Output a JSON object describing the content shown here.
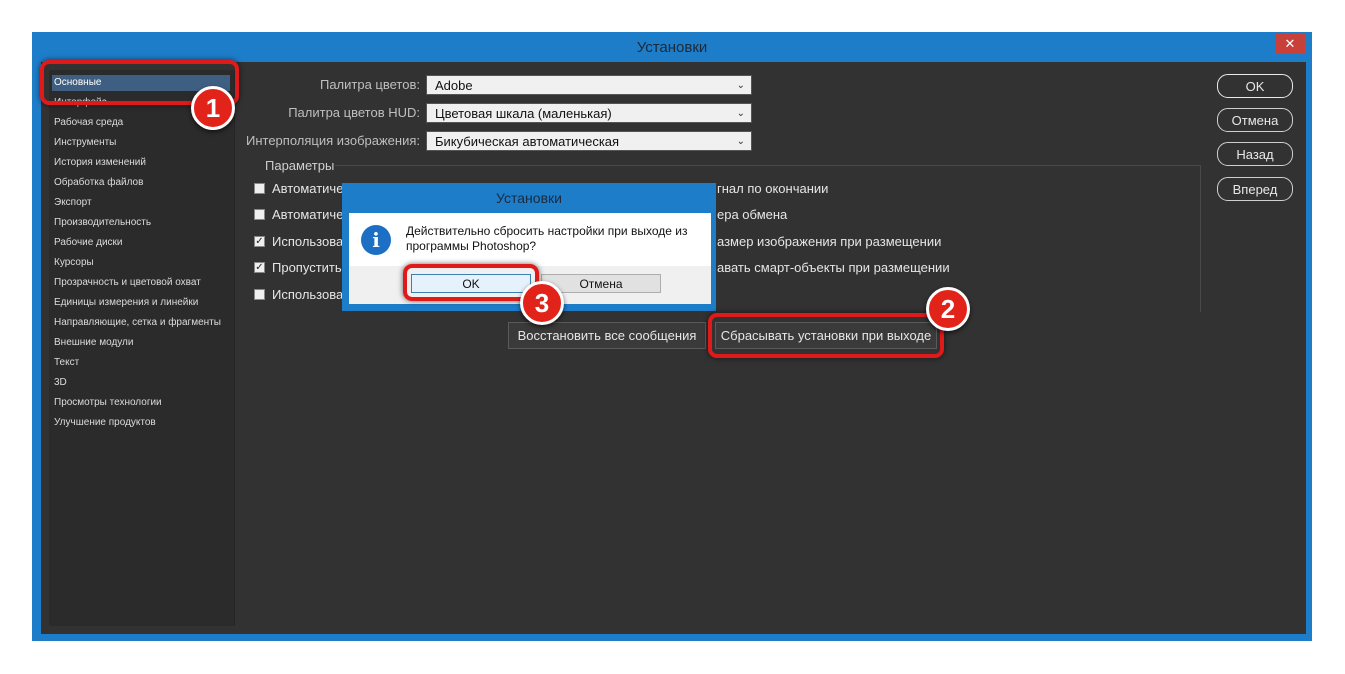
{
  "window": {
    "title": "Установки",
    "close_glyph": "✕"
  },
  "sidebar": {
    "items": [
      {
        "label": "Основные",
        "selected": true
      },
      {
        "label": "Интерфейс"
      },
      {
        "label": "Рабочая среда"
      },
      {
        "label": "Инструменты"
      },
      {
        "label": "История изменений"
      },
      {
        "label": "Обработка файлов"
      },
      {
        "label": "Экспорт"
      },
      {
        "label": "Производительность"
      },
      {
        "label": "Рабочие диски"
      },
      {
        "label": "Курсоры"
      },
      {
        "label": "Прозрачность и цветовой охват"
      },
      {
        "label": "Единицы измерения и линейки"
      },
      {
        "label": "Направляющие, сетка и фрагменты"
      },
      {
        "label": "Внешние модули"
      },
      {
        "label": "Текст"
      },
      {
        "label": "3D"
      },
      {
        "label": "Просмотры технологии"
      },
      {
        "label": "Улучшение продуктов"
      }
    ]
  },
  "main": {
    "color_picker": {
      "label": "Палитра цветов:",
      "value": "Adobe"
    },
    "hud_picker": {
      "label": "Палитра цветов HUD:",
      "value": "Цветовая шкала (маленькая)"
    },
    "interpolation": {
      "label": "Интерполяция изображения:",
      "value": "Бикубическая автоматическая"
    },
    "params_title": "Параметры",
    "left_options": [
      {
        "label": "Автоматически",
        "checked": false
      },
      {
        "label": "Автоматически",
        "checked": false
      },
      {
        "label": "Использовать",
        "checked": true
      },
      {
        "label": "Пропустить",
        "checked": true
      },
      {
        "label": "Использовать",
        "checked": false
      }
    ],
    "right_options": [
      {
        "label": "гнал по окончании"
      },
      {
        "label": "ера обмена"
      },
      {
        "label": "азмер изображения при размещении"
      },
      {
        "label": "авать смарт-объекты при размещении"
      }
    ],
    "restore_messages_button": "Восстановить все сообщения",
    "reset_on_exit_button": "Сбрасывать установки при выходе"
  },
  "right_buttons": {
    "ok": "OK",
    "cancel": "Отмена",
    "back": "Назад",
    "forward": "Вперед"
  },
  "dialog": {
    "title": "Установки",
    "message": "Действительно сбросить настройки при выходе из программы Photoshop?",
    "info_glyph": "i",
    "ok": "OK",
    "cancel": "Отмена"
  },
  "annotations": {
    "badge1": "1",
    "badge2": "2",
    "badge3": "3"
  },
  "colors": {
    "accent_red": "#e0191b",
    "titlebar_blue": "#1e7dc9",
    "panel_bg": "#323232",
    "selection": "#3f5f82"
  }
}
